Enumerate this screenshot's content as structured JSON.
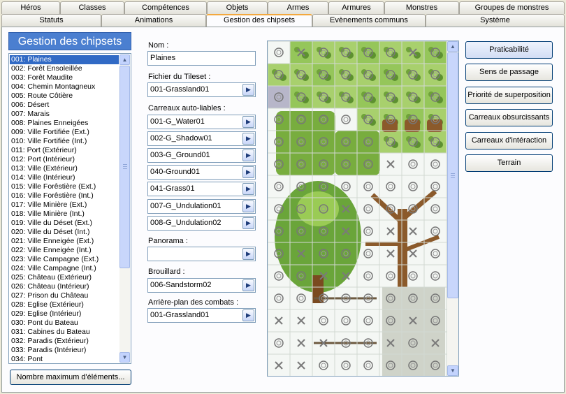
{
  "tabs_row1": [
    "Héros",
    "Classes",
    "Compétences",
    "Objets",
    "Armes",
    "Armures",
    "Monstres",
    "Groupes de monstres"
  ],
  "tabs_row2": [
    "Statuts",
    "Animations",
    "Gestion des chipsets",
    "Evènements communs",
    "Système"
  ],
  "active_tab": "Gestion des chipsets",
  "list": {
    "title": "Gestion des chipsets",
    "selected_index": 0,
    "items": [
      "001: Plaines",
      "002: Forêt Ensoleillée",
      "003: Forêt Maudite",
      "004: Chemin Montagneux",
      "005: Route Côtière",
      "006: Désert",
      "007: Marais",
      "008: Plaines Enneigées",
      "009: Ville Fortifiée (Ext.)",
      "010: Ville Fortifiée (Int.)",
      "011: Port (Extérieur)",
      "012: Port (Intérieur)",
      "013: Ville (Extérieur)",
      "014: Ville (Intérieur)",
      "015: Ville Forêstière (Ext.)",
      "016: Ville Forêstière (Int.)",
      "017: Ville Minière (Ext.)",
      "018: Ville Minière (Int.)",
      "019: Ville du Déset (Ext.)",
      "020: Ville du Déset (Int.)",
      "021: Ville Enneigée (Ext.)",
      "022: Ville Enneigée (Int.)",
      "023: Ville Campagne (Ext.)",
      "024: Ville Campagne (Int.)",
      "025: Château (Extérieur)",
      "026: Château (Intérieur)",
      "027: Prison du Château",
      "028: Eglise (Extérieur)",
      "029: Eglise (Intérieur)",
      "030: Pont du Bateau",
      "031: Cabines du Bateau",
      "032: Paradis (Extérieur)",
      "033: Paradis (Intérieur)",
      "034: Pont"
    ],
    "max_button": "Nombre maximum d'éléments..."
  },
  "form": {
    "name_label": "Nom :",
    "name_value": "Plaines",
    "tileset_label": "Fichier du Tileset :",
    "tileset_value": "001-Grassland01",
    "autotiles_label": "Carreaux auto-liables :",
    "autotiles": [
      "001-G_Water01",
      "002-G_Shadow01",
      "003-G_Ground01",
      "040-Ground01",
      "041-Grass01",
      "007-G_Undulation01",
      "008-G_Undulation02"
    ],
    "panorama_label": "Panorama :",
    "panorama_value": "",
    "fog_label": "Brouillard :",
    "fog_value": "006-Sandstorm02",
    "battleback_label": "Arrière-plan des combats :",
    "battleback_value": "001-Grassland01"
  },
  "buttons": [
    "Praticabilité",
    "Sens de passage",
    "Priorité de superposition",
    "Carreaux obsurcissants",
    "Carreaux d'intéraction",
    "Terrain"
  ],
  "active_button": "Praticabilité",
  "colors": {
    "list_title_bg": "#4b7fd0",
    "selection": "#316ac5",
    "tab_accent": "#f3a83e",
    "grass": "#7cb342",
    "tree_trunk": "#8b5a2b"
  }
}
